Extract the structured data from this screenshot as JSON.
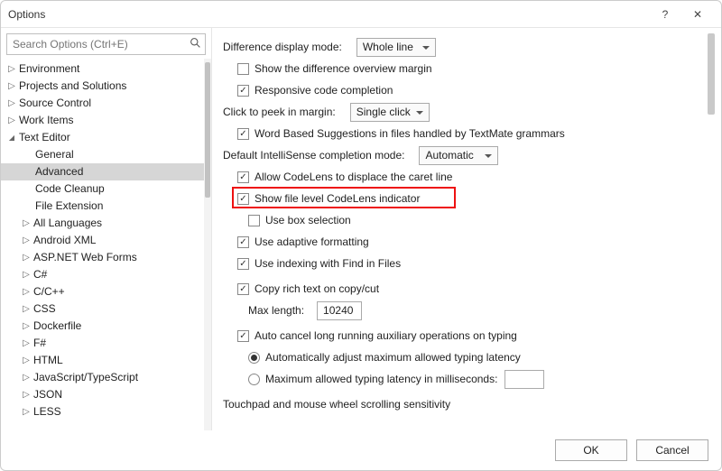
{
  "window": {
    "title": "Options",
    "help_icon": "?",
    "close_icon": "✕"
  },
  "search": {
    "placeholder": "Search Options (Ctrl+E)"
  },
  "tree": [
    {
      "label": "Environment",
      "caret": "right",
      "depth": 0
    },
    {
      "label": "Projects and Solutions",
      "caret": "right",
      "depth": 0
    },
    {
      "label": "Source Control",
      "caret": "right",
      "depth": 0
    },
    {
      "label": "Work Items",
      "caret": "right",
      "depth": 0
    },
    {
      "label": "Text Editor",
      "caret": "down",
      "depth": 0
    },
    {
      "label": "General",
      "caret": "none",
      "depth": 1
    },
    {
      "label": "Advanced",
      "caret": "none",
      "depth": 1,
      "selected": true
    },
    {
      "label": "Code Cleanup",
      "caret": "none",
      "depth": 1
    },
    {
      "label": "File Extension",
      "caret": "none",
      "depth": 1
    },
    {
      "label": "All Languages",
      "caret": "right",
      "depth": 1
    },
    {
      "label": "Android XML",
      "caret": "right",
      "depth": 1
    },
    {
      "label": "ASP.NET Web Forms",
      "caret": "right",
      "depth": 1
    },
    {
      "label": "C#",
      "caret": "right",
      "depth": 1
    },
    {
      "label": "C/C++",
      "caret": "right",
      "depth": 1
    },
    {
      "label": "CSS",
      "caret": "right",
      "depth": 1
    },
    {
      "label": "Dockerfile",
      "caret": "right",
      "depth": 1
    },
    {
      "label": "F#",
      "caret": "right",
      "depth": 1
    },
    {
      "label": "HTML",
      "caret": "right",
      "depth": 1
    },
    {
      "label": "JavaScript/TypeScript",
      "caret": "right",
      "depth": 1
    },
    {
      "label": "JSON",
      "caret": "right",
      "depth": 1
    },
    {
      "label": "LESS",
      "caret": "right",
      "depth": 1
    }
  ],
  "panel": {
    "diff_mode_label": "Difference display mode:",
    "diff_mode_value": "Whole line",
    "show_diff_overview": "Show the difference overview margin",
    "responsive_completion": "Responsive code completion",
    "click_peek_label": "Click to peek in margin:",
    "click_peek_value": "Single click",
    "word_based": "Word Based Suggestions in files handled by TextMate grammars",
    "intellisense_label": "Default IntelliSense completion mode:",
    "intellisense_value": "Automatic",
    "allow_codelens": "Allow CodeLens to displace the caret line",
    "show_file_codelens": "Show file level CodeLens indicator",
    "use_box_selection": "Use box selection",
    "use_adaptive_fmt": "Use adaptive formatting",
    "use_indexing_find": "Use indexing with Find in Files",
    "copy_rich_text": "Copy rich text on copy/cut",
    "max_length_label": "Max length:",
    "max_length_value": "10240",
    "auto_cancel": "Auto cancel long running auxiliary operations on typing",
    "auto_adjust_latency": "Automatically adjust maximum allowed typing latency",
    "max_latency_ms": "Maximum allowed typing latency in milliseconds:",
    "touchpad_section": "Touchpad and mouse wheel scrolling sensitivity"
  },
  "footer": {
    "ok": "OK",
    "cancel": "Cancel"
  }
}
